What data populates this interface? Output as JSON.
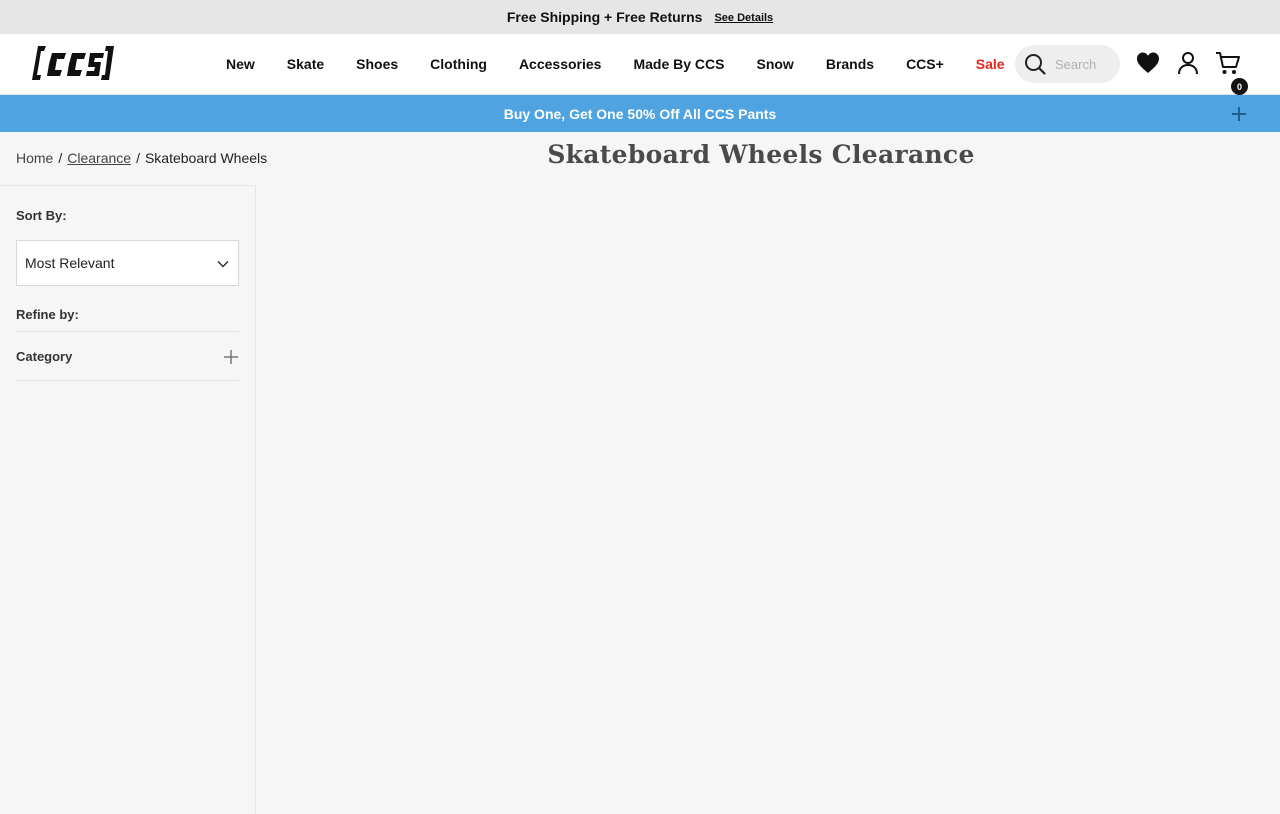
{
  "promo": {
    "text": "Free Shipping + Free Returns",
    "link": "See Details"
  },
  "header": {
    "logo_alt": "[ccs]",
    "nav": [
      "New",
      "Skate",
      "Shoes",
      "Clothing",
      "Accessories",
      "Made By CCS",
      "Snow",
      "Brands",
      "CCS+",
      "Sale"
    ],
    "sale_color": "#e1261c",
    "search_placeholder": "Search",
    "cart_count": "0",
    "icons": [
      "search-icon",
      "heart-icon",
      "account-icon",
      "cart-icon"
    ]
  },
  "offer": {
    "text": "Buy One, Get One 50% Off All CCS Pants",
    "bg_color": "#4ea3e0"
  },
  "breadcrumb": {
    "home": "Home",
    "sep1": "/",
    "clearance": "Clearance",
    "sep2": "/",
    "current": "Skateboard Wheels"
  },
  "page_title": "Skateboard Wheels Clearance",
  "sidebar": {
    "sort_label": "Sort By:",
    "sort_value": "Most Relevant",
    "refine_label": "Refine by:",
    "category_label": "Category"
  }
}
